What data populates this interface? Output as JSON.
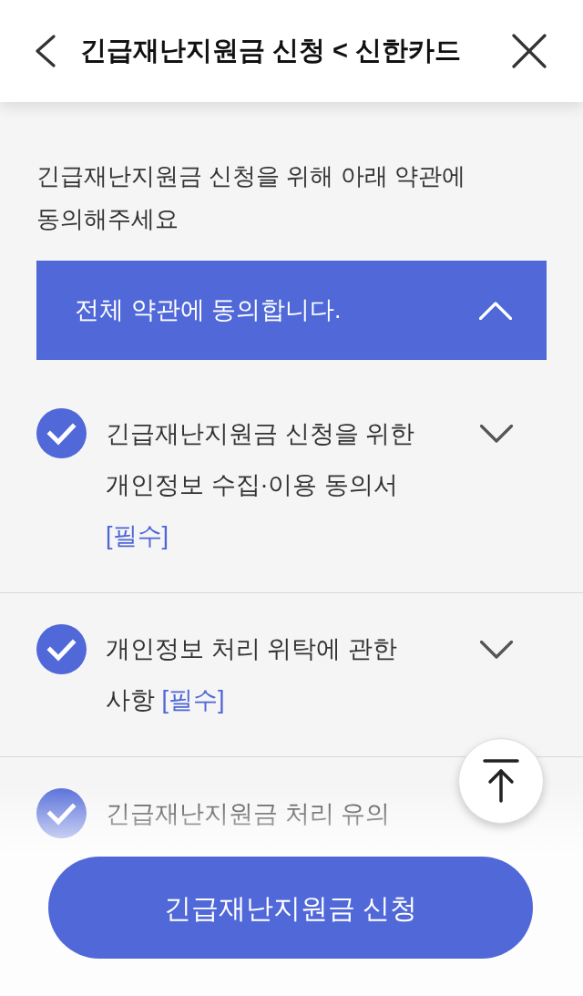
{
  "header": {
    "title": "긴급재난지원금 신청 < 신한카드"
  },
  "intro": "긴급재난지원금 신청을 위해 아래 약관에 동의해주세요",
  "agree_all": {
    "label": "전체 약관에 동의합니다.",
    "expanded": true
  },
  "terms": [
    {
      "title": "긴급재난지원금 신청을 위한 개인정보 수집·이용 동의서",
      "tag": "[필수]",
      "checked": true,
      "expanded": false
    },
    {
      "title": "개인정보 처리 위탁에 관한 사항",
      "tag": "[필수]",
      "checked": true,
      "expanded": false
    },
    {
      "title": "긴급재난지원금 처리 유의",
      "checked": true
    }
  ],
  "apply_button": {
    "label": "긴급재난지원금 신청"
  }
}
